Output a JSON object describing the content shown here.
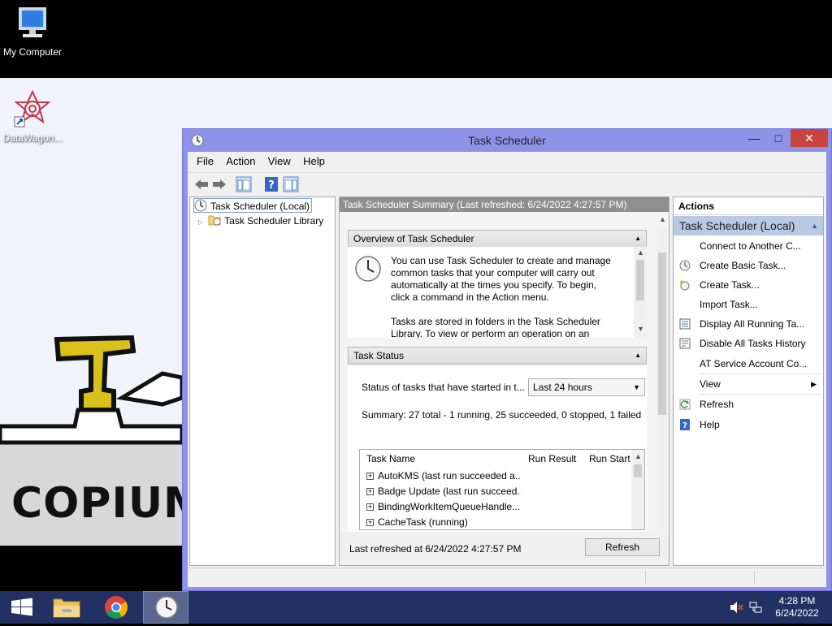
{
  "desktop": {
    "icons": [
      {
        "label": "My Computer"
      },
      {
        "label": "DataWagon..."
      }
    ],
    "wallpaper_text": "COPIUM"
  },
  "window": {
    "title": "Task Scheduler",
    "menu": [
      "File",
      "Action",
      "View",
      "Help"
    ]
  },
  "tree": {
    "items": [
      {
        "label": "Task Scheduler (Local)"
      },
      {
        "label": "Task Scheduler Library"
      }
    ]
  },
  "summary": {
    "header": "Task Scheduler Summary (Last refreshed: 6/24/2022 4:27:57 PM)",
    "overview": {
      "title": "Overview of Task Scheduler",
      "para1": "You can use Task Scheduler to create and manage common tasks that your computer will carry out automatically at the times you specify. To begin, click a command in the Action menu.",
      "para2": "Tasks are stored in folders in the Task Scheduler Library. To view or perform an operation on an"
    },
    "task_status": {
      "title": "Task Status",
      "label": "Status of tasks that have started in t...",
      "dropdown_value": "Last 24 hours",
      "summary": "Summary: 27 total - 1 running, 25 succeeded, 0 stopped, 1 failed",
      "columns": [
        "Task Name",
        "Run Result",
        "Run Start"
      ],
      "rows": [
        "AutoKMS (last run succeeded a...",
        "Badge Update (last run succeed...",
        "BindingWorkItemQueueHandle...",
        "CacheTask (running)"
      ]
    },
    "footer": {
      "last_refreshed": "Last refreshed at 6/24/2022 4:27:57 PM",
      "refresh_button": "Refresh"
    }
  },
  "actions": {
    "title": "Actions",
    "group": "Task Scheduler (Local)",
    "items": [
      {
        "label": "Connect to Another C...",
        "icon": "none"
      },
      {
        "label": "Create Basic Task...",
        "icon": "clock-wand-icon"
      },
      {
        "label": "Create Task...",
        "icon": "clock-star-icon"
      },
      {
        "label": "Import Task...",
        "icon": "none"
      },
      {
        "label": "Display All Running Ta...",
        "icon": "list-icon"
      },
      {
        "label": "Disable All Tasks History",
        "icon": "history-icon"
      },
      {
        "label": "AT Service Account Co...",
        "icon": "none"
      },
      {
        "label": "View",
        "icon": "none"
      },
      {
        "label": "Refresh",
        "icon": "refresh-icon"
      },
      {
        "label": "Help",
        "icon": "help-icon"
      }
    ]
  },
  "taskbar": {
    "time": "4:28 PM",
    "date": "6/24/2022"
  }
}
